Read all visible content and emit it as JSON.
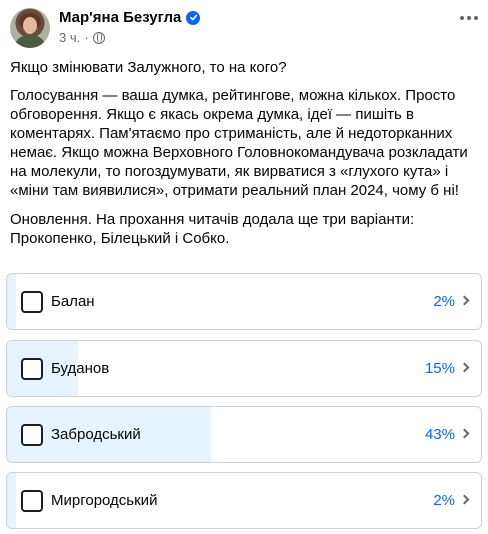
{
  "author": {
    "name": "Мар'яна Безугла",
    "time": "3 ч."
  },
  "post": {
    "title": "Якщо змінювати Залужного, то на кого?",
    "body": "Голосування — ваша думка, рейтингове, можна кількох. Просто обговорення. Якщо є якась окрема думка, ідеї — пишіть в коментарях. Пам'ятаємо про стриманість, але й недоторканних немає. Якщо можна Верховного Головнокомандувача розкладати на молекули, то поroздумувати, як вирватися з «глухого кута» і «міни там виявилися», отримати реальний план 2024, чому б ні!",
    "update": "Оновлення. На прохання читачів додала ще три варіанти: Прокопенко, Білецький і Собко."
  },
  "poll": {
    "options": [
      {
        "label": "Балан",
        "percent": "2%",
        "value": 2
      },
      {
        "label": "Буданов",
        "percent": "15%",
        "value": 15
      },
      {
        "label": "Забродський",
        "percent": "43%",
        "value": 43
      },
      {
        "label": "Миргородський",
        "percent": "2%",
        "value": 2
      }
    ]
  },
  "colors": {
    "accent": "#0866ff",
    "fill": "#e7f3ff"
  }
}
